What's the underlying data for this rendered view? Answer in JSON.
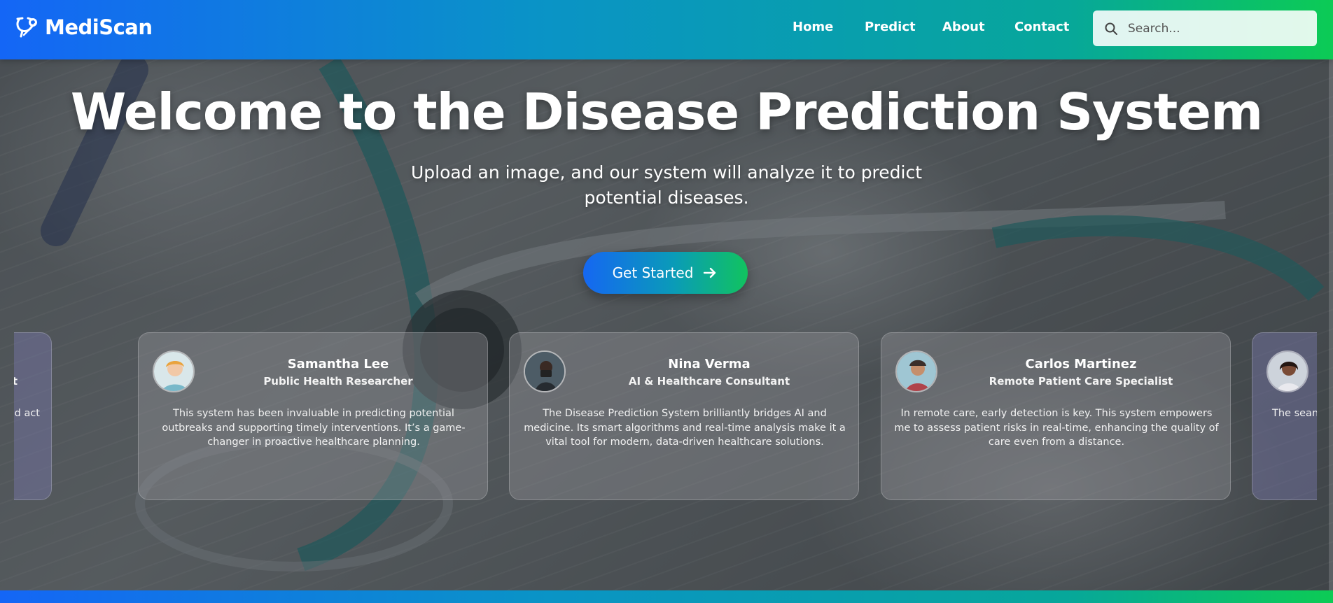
{
  "brand": {
    "name": "MediScan",
    "icon": "stethoscope-icon"
  },
  "nav": {
    "items": [
      {
        "label": "Home"
      },
      {
        "label": "Predict"
      },
      {
        "label": "About"
      },
      {
        "label": "Contact"
      }
    ],
    "search_placeholder": "Search...",
    "search_icon": "search-icon"
  },
  "hero": {
    "title": "Welcome to the Disease Prediction System",
    "subtitle": "Upload an image, and our system will analyze it to predict potential diseases.",
    "cta_label": "Get Started",
    "cta_icon": "arrow-right-icon"
  },
  "testimonials": [
    {
      "name": "",
      "role": "alyst",
      "quote": "stands out for its into actionable derstand and act"
    },
    {
      "name": "Samantha Lee",
      "role": "Public Health Researcher",
      "quote": "This system has been invaluable in predicting potential outbreaks and supporting timely interventions. It’s a game-changer in proactive healthcare planning."
    },
    {
      "name": "Nina Verma",
      "role": "AI & Healthcare Consultant",
      "quote": "The Disease Prediction System brilliantly bridges AI and medicine. Its smart algorithms and real-time analysis make it a vital tool for modern, data-driven healthcare solutions."
    },
    {
      "name": "Carlos Martinez",
      "role": "Remote Patient Care Specialist",
      "quote": "In remote care, early detection is key. This system empowers me to assess patient risks in real-time, enhancing the quality of care even from a distance."
    },
    {
      "name": "",
      "role": "",
      "quote": "The sean advan essenti"
    }
  ],
  "colors": {
    "gradient_start": "#1466f6",
    "gradient_mid": "#07a79a",
    "gradient_end": "#0ccb55"
  }
}
